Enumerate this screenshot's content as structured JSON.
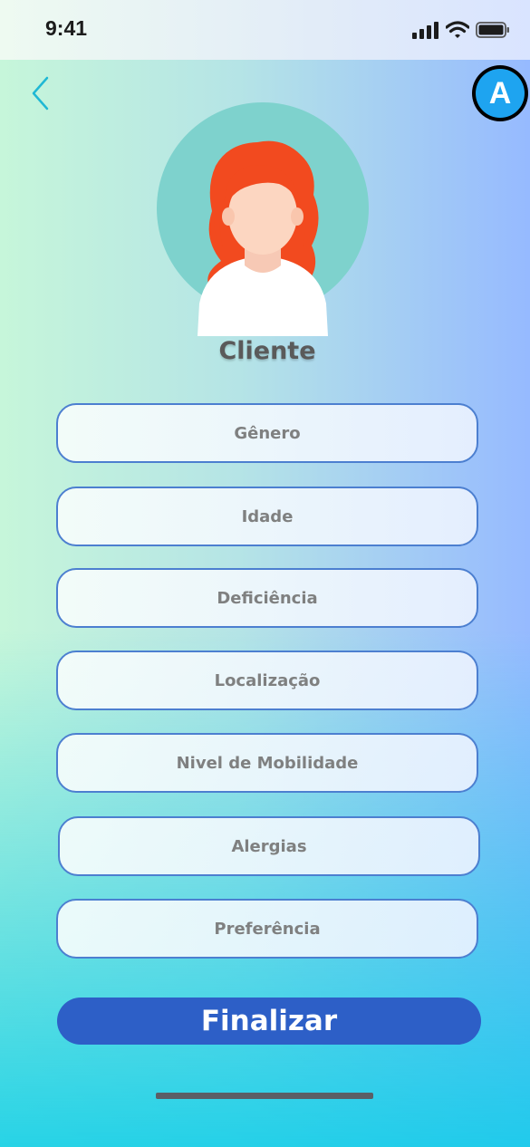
{
  "status_bar": {
    "time": "9:41"
  },
  "header": {
    "back_icon": "chevron-left-icon",
    "badge_letter": "A"
  },
  "profile": {
    "avatar_icon": "woman-avatar",
    "title": "Cliente"
  },
  "fields": [
    {
      "label": "Gênero"
    },
    {
      "label": "Idade"
    },
    {
      "label": "Deficiência"
    },
    {
      "label": "Localização"
    },
    {
      "label": "Nivel de Mobilidade"
    },
    {
      "label": "Alergias"
    },
    {
      "label": "Preferência"
    }
  ],
  "actions": {
    "finish_label": "Finalizar"
  },
  "colors": {
    "accent": "#2D5FC7",
    "field_border": "#4C7FD0",
    "badge": "#1EA4F0",
    "avatar_bg": "#7ED2CD",
    "hair": "#F24A1F"
  }
}
